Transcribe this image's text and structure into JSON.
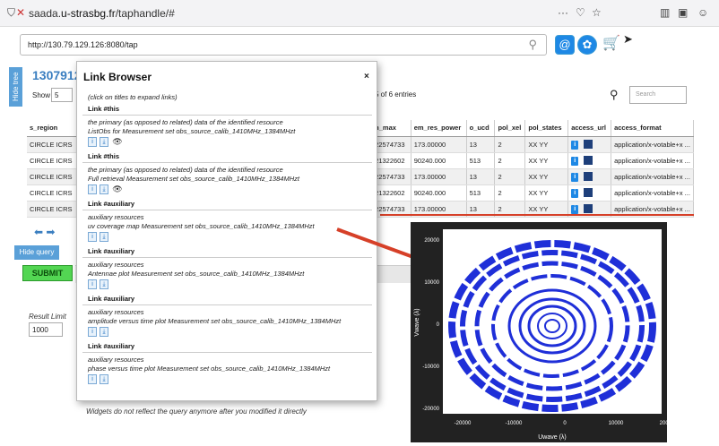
{
  "browser": {
    "url_prefix": "saada.",
    "url_domain": "u-strasbg.fr",
    "url_path": "/taphandle/#",
    "more": "···"
  },
  "app": {
    "url_field": "http://130.79.129.126:8080/tap",
    "hide_tree": "Hide tree",
    "title": "1307912",
    "show_label": "Show",
    "show_value": "5",
    "entries_text": "5 of 6 entries",
    "search_placeholder": "Search",
    "hide_query": "Hide query",
    "submit": "SUBMIT",
    "result_limit_label": "Result Limit",
    "result_limit_value": "1000",
    "widgets_note": "Widgets do not reflect the query anymore after you modified it directly"
  },
  "table": {
    "columns": [
      "s_region",
      "",
      "em_max",
      "em_res_power",
      "o_ucd",
      "pol_xel",
      "pol_states",
      "access_url",
      "access_format"
    ],
    "rows": [
      [
        "CIRCLE ICRS",
        "0",
        "0.22574733",
        "173.00000",
        "13",
        "2",
        "XX YY",
        "i",
        "application/x-votable+x ..."
      ],
      [
        "CIRCLE ICRS",
        "0",
        "0.21322602",
        "90240.000",
        "513",
        "2",
        "XX YY",
        "i",
        "application/x-votable+x ..."
      ],
      [
        "CIRCLE ICRS",
        "0",
        "0.22574733",
        "173.00000",
        "13",
        "2",
        "XX YY",
        "i",
        "application/x-votable+x ..."
      ],
      [
        "CIRCLE ICRS",
        "0",
        "0.21322602",
        "90240.000",
        "513",
        "2",
        "XX YY",
        "i",
        "application/x-votable+x ..."
      ],
      [
        "CIRCLE ICRS",
        "0",
        "0.22574733",
        "173.00000",
        "13",
        "2",
        "XX YY",
        "i",
        "application/x-votable+x ..."
      ]
    ]
  },
  "link_browser": {
    "title": "Link Browser",
    "close": "×",
    "hint": "(click on titles to expand links)",
    "sections": [
      {
        "head": "Link #this",
        "desc": "the primary (as opposed to related) data of the identified resource",
        "name": "ListObs for Measurement set obs_source_calib_1410MHz_1384MHzt",
        "eye": true
      },
      {
        "head": "Link #this",
        "desc": "the primary (as opposed to related) data of the identified resource",
        "name": "Full retrieval Measurement set obs_source_calib_1410MHz_1384MHzt",
        "eye": true
      },
      {
        "head": "Link #auxiliary",
        "desc": "auxiliary resources",
        "name": "uv coverage map Measurement set obs_source_calib_1410MHz_1384MHzt",
        "eye": false
      },
      {
        "head": "Link #auxiliary",
        "desc": "auxiliary resources",
        "name": "Antennae plot Measurement set obs_source_calib_1410MHz_1384MHzt",
        "eye": false
      },
      {
        "head": "Link #auxiliary",
        "desc": "auxiliary resources",
        "name": "amplitude versus time plot Measurement set obs_source_calib_1410MHz_1384MHzt",
        "eye": false
      },
      {
        "head": "Link #auxiliary",
        "desc": "auxiliary resources",
        "name": "phase versus time plot Measurement set obs_source_calib_1410MHz_1384MHzt",
        "eye": false
      }
    ]
  },
  "plot": {
    "xlabel": "Uwave (λ)",
    "ylabel": "Vwave (λ)",
    "xticks": [
      "-20000",
      "-10000",
      "0",
      "10000",
      "20000"
    ],
    "yticks": [
      "20000",
      "10000",
      "0",
      "-10000",
      "-20000"
    ],
    "point_color": "#1f2fd8"
  },
  "colors": {
    "accent": "#3a7ec0",
    "arrow": "#d64028",
    "submit": "#53d653"
  }
}
